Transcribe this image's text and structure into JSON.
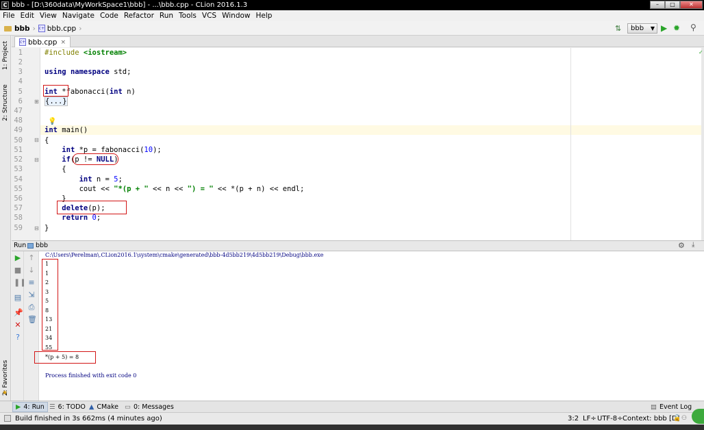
{
  "window": {
    "title": "bbb - [D:\\360data\\MyWorkSpace1\\bbb] - ...\\bbb.cpp - CLion 2016.1.3",
    "app_icon": "C"
  },
  "menu": [
    "File",
    "Edit",
    "View",
    "Navigate",
    "Code",
    "Refactor",
    "Run",
    "Tools",
    "VCS",
    "Window",
    "Help"
  ],
  "nav": {
    "project": "bbb",
    "file": "bbb.cpp",
    "run_config": "bbb"
  },
  "side_tabs": {
    "project": "1: Project",
    "structure": "2: Structure",
    "favorites": "2: Favorites"
  },
  "editor": {
    "tab_label": "bbb.cpp",
    "tab_close": "×",
    "lines": [
      {
        "num": "1"
      },
      {
        "num": "2"
      },
      {
        "num": "3"
      },
      {
        "num": "4"
      },
      {
        "num": "5"
      },
      {
        "num": "6"
      },
      {
        "num": "47"
      },
      {
        "num": "48"
      },
      {
        "num": "49"
      },
      {
        "num": "50"
      },
      {
        "num": "51"
      },
      {
        "num": "52"
      },
      {
        "num": "53"
      },
      {
        "num": "54"
      },
      {
        "num": "55"
      },
      {
        "num": "56"
      },
      {
        "num": "57"
      },
      {
        "num": "58"
      },
      {
        "num": "59"
      }
    ],
    "code": {
      "l1_kw": "#include ",
      "l1_arg": "<iostream>",
      "l3_kw1": "using",
      "l3_kw2": "namespace",
      "l3_rest": " std;",
      "l5_kw": "int",
      "l5_rest": " *fabonacci(",
      "l5_kw2": "int",
      "l5_end": " n)",
      "l6_fold": "{...}",
      "l49_kw": "int",
      "l49_rest": " main()",
      "l50": "{",
      "l51_kw": "int",
      "l51_rest": " *p = fabonacci(",
      "l51_num": "10",
      "l51_end": ");",
      "l52_kw": "if",
      "l52_rest": "(p != ",
      "l52_kw2": "NULL",
      "l52_end": ")",
      "l53": "{",
      "l54_kw": "int",
      "l54_rest": " n = ",
      "l54_num": "5",
      "l54_end": ";",
      "l55_a": "cout << ",
      "l55_s1": "\"*(p + \"",
      "l55_b": " << n << ",
      "l55_s2": "\") = \"",
      "l55_c": " << *(p + n) << endl;",
      "l56": "}",
      "l57_kw": "delete",
      "l57_rest": "(p);",
      "l58_kw": "return",
      "l58_num": " 0",
      "l58_end": ";",
      "l59": "}"
    }
  },
  "run_panel": {
    "title": "Run",
    "config": "bbb",
    "console_path": "C:\\Users\\Perelman\\.CLion2016.1\\system\\cmake\\generated\\bbb-4d5bb219\\4d5bb219\\Debug\\bbb.exe",
    "output": [
      "1",
      "1",
      "2",
      "3",
      "5",
      "8",
      "13",
      "21",
      "34",
      "55"
    ],
    "result": "*(p + 5) = 8",
    "finished": "Process finished with exit code 0"
  },
  "tool_tabs": {
    "run": "4: Run",
    "todo": "6: TODO",
    "cmake": "CMake",
    "messages": "0: Messages",
    "event_log": "Event Log"
  },
  "status": {
    "message": "Build finished in 3s 662ms (4 minutes ago)",
    "position": "3:2",
    "line_sep": "LF÷",
    "encoding": "UTF-8÷",
    "context": "Context: bbb [D]"
  },
  "colors": {
    "keyword": "#000080",
    "string": "#008000",
    "number": "#0000ff",
    "highlight_box": "#d21414",
    "current_line": "#fffae3"
  }
}
